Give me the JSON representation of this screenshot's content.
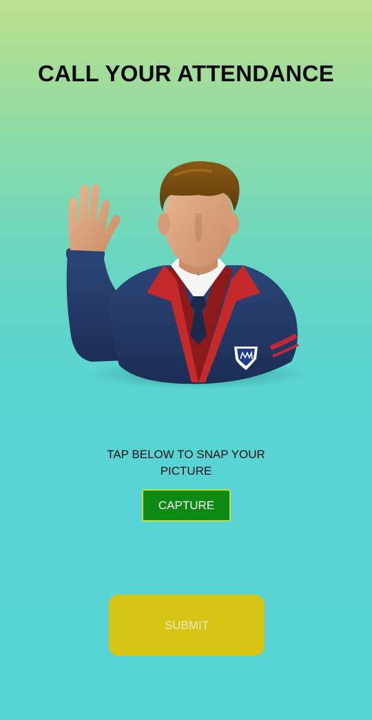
{
  "header": {
    "title": "CALL YOUR ATTENDANCE"
  },
  "illustration": {
    "icon": "student-raising-hand-icon"
  },
  "capture_section": {
    "prompt": "TAP BELOW TO SNAP YOUR PICTURE",
    "capture_label": "CAPTURE"
  },
  "footer": {
    "submit_label": "SUBMIT"
  },
  "colors": {
    "background_top": "#bde08c",
    "background_bottom": "#57d4d4",
    "capture_button": "#0c8a13",
    "capture_border": "#c9de3a",
    "submit_button": "#d6c515"
  }
}
